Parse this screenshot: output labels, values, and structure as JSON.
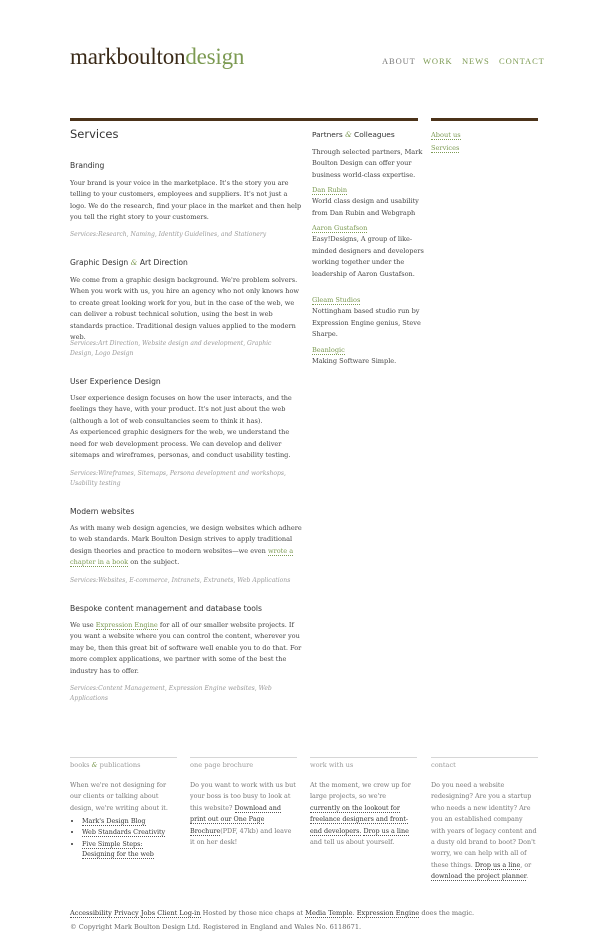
{
  "logo": {
    "part1": "markboulton",
    "part2": "design"
  },
  "nav": [
    {
      "label": "ABOUT",
      "color": "#777777"
    },
    {
      "label": "WORK",
      "color": "#7c9a52"
    },
    {
      "label": "NEWS",
      "color": "#7c9a52"
    },
    {
      "label": "CONTACT",
      "color": "#7c9a52"
    }
  ],
  "main": {
    "title": "Services",
    "sections": [
      {
        "heading": "Branding",
        "text": "Your brand is your voice in the marketplace. It's the story you are telling to your customers, employees and suppliers. It's not just a logo. We do the research, find your place in the market and then help you tell the right story to your customers.",
        "tags": "Services:Research, Naming, Identity Guidelines, and Stationery"
      },
      {
        "heading_a": "Graphic Design",
        "heading_amp": "&",
        "heading_b": "Art Direction",
        "text": "We come from a graphic design background. We're problem solvers. When you work with us, you hire an agency who not only knows how to create great looking work for you, but in the case of the web, we can deliver a robust technical solution, using the best in web standards practice. Traditional design values applied to the modern web.",
        "tags": "Services:Art Direction, Website design and development, Graphic Design, Logo Design"
      },
      {
        "heading": "User Experience Design",
        "text": "User experience design focuses on how the user interacts, and the feelings they have, with your product. It's not just about the web (although a lot of web consultancies seem to think it has).",
        "text2": "As experienced graphic designers for the web, we understand the need for web development process. We can develop and deliver sitemaps and wireframes, personas, and conduct usability testing.",
        "tags": "Services:Wireframes, Sitemaps, Persona development and workshops, Usability testing"
      },
      {
        "heading": "Modern websites",
        "text_before": "As with many web design agencies, we design websites which adhere to web standards. Mark Boulton Design strives to apply traditional design theories and practice to modern websites—we even",
        "link": "wrote a chapter in a book",
        "text_after": "on the subject.",
        "tags": "Services:Websites, E-commerce, Intranets, Extranets, Web Applications"
      },
      {
        "heading": "Bespoke content management and database tools",
        "text_before": "We use",
        "link": "Expression Engine",
        "text_after": "for all of our smaller website projects. If you want a website where you can control the content, wherever you may be, then this great bit of software well enable you to do that. For more complex applications, we partner with some of the best the industry has to offer.",
        "tags": "Services:Content Management, Expression Engine websites, Web Applications"
      }
    ]
  },
  "partners": {
    "heading_a": "Partners",
    "heading_amp": "&",
    "heading_b": "Colleagues",
    "intro": "Through selected partners, Mark Boulton Design can offer your business world-class expertise.",
    "items": [
      {
        "name": "Dan Rubin",
        "desc": "World class design and usability from Dan Rubin and Webgraph"
      },
      {
        "name": "Aaron Gustafson",
        "desc": "Easy!Designs, A group of like-minded designers and developers working together under the leadership of Aaron Gustafson."
      },
      {
        "name": "Gleam Studios",
        "desc": "Nottingham based studio run by Expression Engine genius, Steve Sharpe."
      },
      {
        "name": "Beanlogic",
        "desc": "Making Software Simple."
      }
    ]
  },
  "subnav": {
    "items": [
      "About us",
      "Services"
    ]
  },
  "footer": {
    "books": {
      "heading_a": "books",
      "heading_amp": "&",
      "heading_b": "publications",
      "text": "When we're not designing for our clients or talking about design, we're writing about it.",
      "links": [
        "Mark's Design Blog",
        "Web Standards Creativity",
        "Five Simple Steps: Designing for the web"
      ]
    },
    "brochure": {
      "heading": "one page brochure",
      "text1": "Do you want to work with us but your boss is too busy to look at this website?",
      "link": "Download and print out our One Page Brochure",
      "text2": "(PDF, 47kb) and leave it on her desk!"
    },
    "work": {
      "heading": "work with us",
      "text1": "At the moment, we crew up for large projects, so we're",
      "link1": "currently on the lookout for freelance designers and front-end developers.",
      "link2": "Drop us a line",
      "text2": "and tell us about yourself."
    },
    "contact": {
      "heading": "contact",
      "text1": "Do you need a website redesigning? Are you a startup who needs a new identity? Are you an established company with years of legacy content and a dusty old brand to boot? Don't worry, we can help with all of these things.",
      "link1": "Drop us a line",
      "text2": ", or",
      "link2": "download the project planner",
      "text3": "."
    },
    "bottom_links": [
      "Accessibility",
      "Privacy",
      "Jobs",
      "Client Log-in"
    ],
    "hosted_text1": "Hosted by those nice chaps at",
    "hosted_link1": "Media Temple",
    "hosted_link2": "Expression Engine",
    "hosted_text2": "does the magic.",
    "copyright": "© Copyright Mark Boulton Design Ltd. Registered in England and Wales No. 6118671."
  }
}
